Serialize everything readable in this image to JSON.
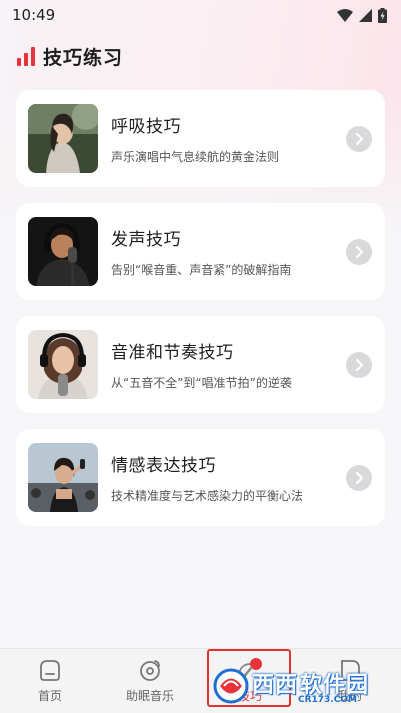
{
  "status_bar": {
    "time": "10:49"
  },
  "header": {
    "title": "技巧练习"
  },
  "cards": [
    {
      "title": "呼吸技巧",
      "subtitle": "声乐演唱中气息续航的黄金法则",
      "thumb": "woman-outdoor-singing-photo"
    },
    {
      "title": "发声技巧",
      "subtitle": "告别“喉音重、声音紧”的破解指南",
      "thumb": "man-headphones-microphone-photo"
    },
    {
      "title": "音准和节奏技巧",
      "subtitle": "从“五音不全”到“唱准节拍”的逆袭",
      "thumb": "woman-headphones-studio-photo"
    },
    {
      "title": "情感表达技巧",
      "subtitle": "技术精准度与艺术感染力的平衡心法",
      "thumb": "woman-stage-microphone-photo"
    }
  ],
  "bottom_nav": {
    "items": [
      {
        "label": "首页",
        "icon": "home-icon"
      },
      {
        "label": "助眠音乐",
        "icon": "music-disc-icon"
      },
      {
        "label": "技巧",
        "icon": "microphone-icon",
        "active": true
      },
      {
        "label": "我的",
        "icon": "profile-icon"
      }
    ]
  },
  "watermark": {
    "text_blue": "西西",
    "text_red": "软件园",
    "url": "CR173.COM"
  },
  "colors": {
    "accent": "#e8333c",
    "background": "#f6f5f7",
    "card": "#ffffff"
  }
}
